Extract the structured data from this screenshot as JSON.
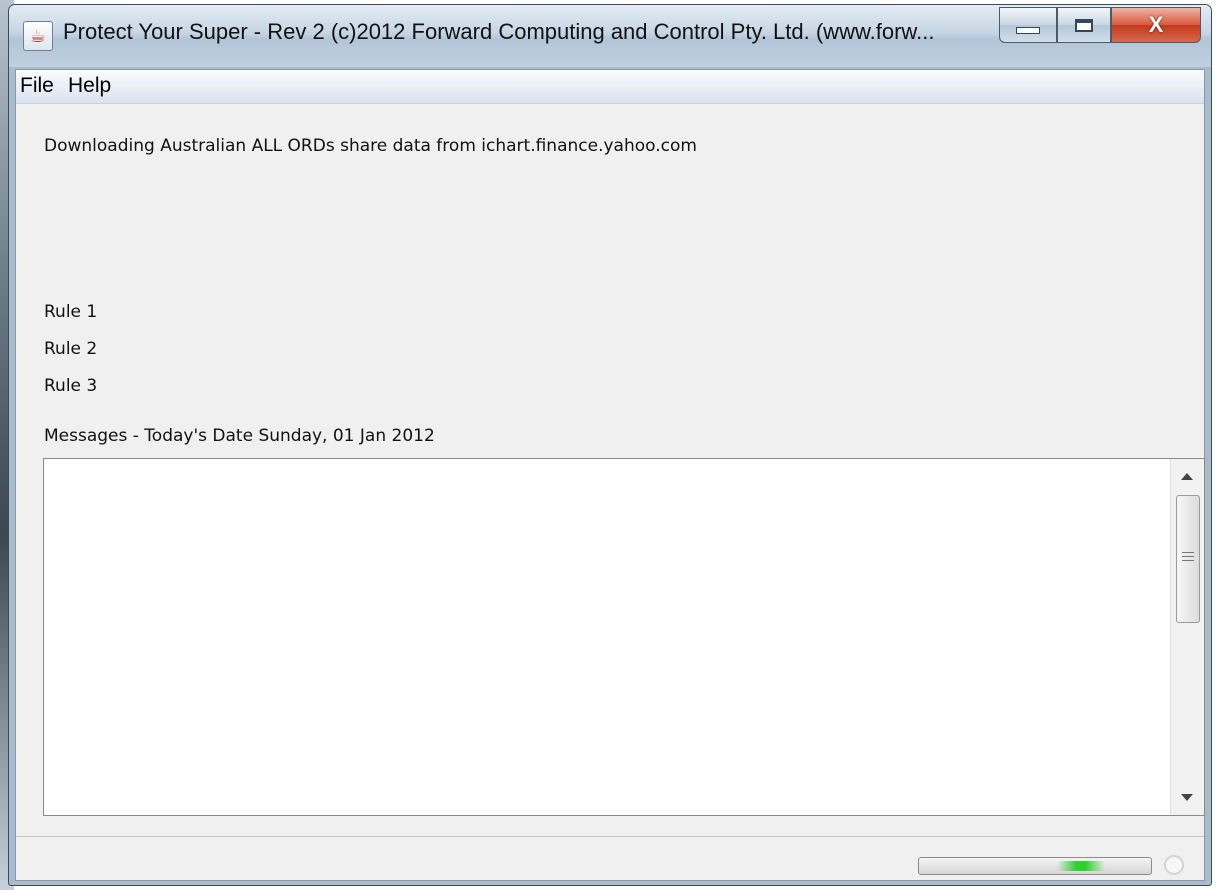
{
  "window": {
    "title": "Protect Your Super - Rev 2 (c)2012 Forward Computing and Control Pty. Ltd. (www.forw...",
    "app_icon": "java-cup-icon",
    "controls": {
      "minimize_icon": "minimize-icon",
      "maximize_icon": "maximize-icon",
      "close_icon": "close-icon",
      "close_glyph": "X"
    }
  },
  "menubar": {
    "items": [
      {
        "label": "File"
      },
      {
        "label": "Help"
      }
    ]
  },
  "main": {
    "status_line": "Downloading Australian ALL ORDs share data from ichart.finance.yahoo.com",
    "rules": [
      "Rule 1",
      "Rule 2",
      "Rule 3"
    ],
    "messages_label": "Messages - Today's Date Sunday, 01 Jan 2012",
    "messages_text": ""
  },
  "statusbar": {
    "progress_indeterminate": true,
    "busy_icon": "busy-circle-icon"
  },
  "colors": {
    "titlebar": "#bfd0df",
    "client_bg": "#f0f0f0",
    "close_button": "#c1391f",
    "progress_glow": "#2fd12f"
  }
}
